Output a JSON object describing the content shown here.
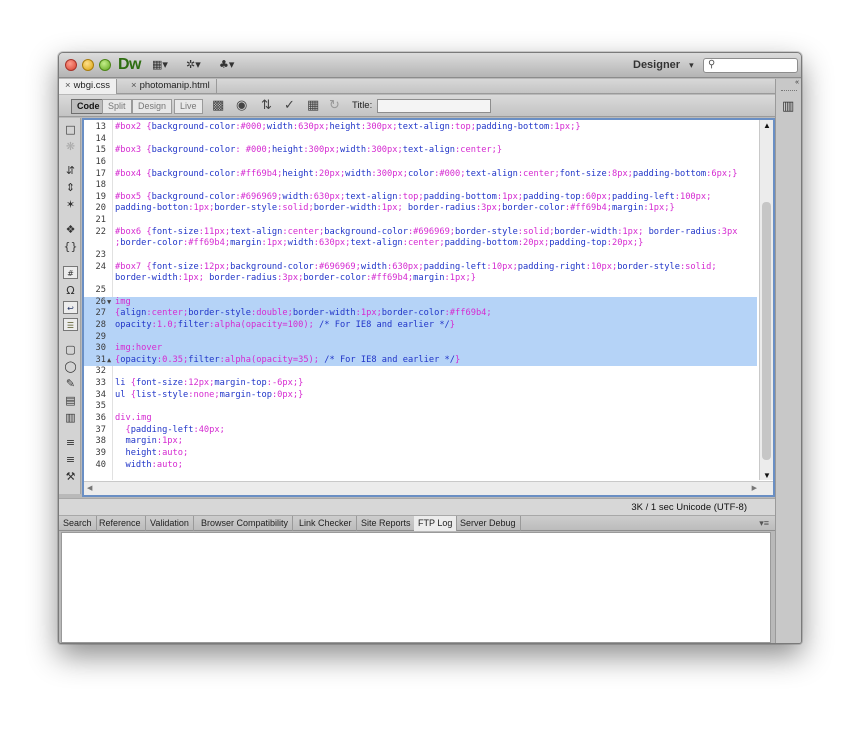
{
  "app": {
    "logo": "Dw",
    "workspace": "Designer",
    "workspace_caret": "▾",
    "search_placeholder": ""
  },
  "titlebar_icons": [
    "▦▾",
    "✲▾",
    "♣▾"
  ],
  "doc_tabs": [
    {
      "label": "wbgi.css",
      "close": "×"
    },
    {
      "label": "photomanip.html",
      "close": "×"
    }
  ],
  "toolbar": {
    "views": [
      "Code",
      "Split",
      "Design",
      "Live"
    ],
    "title_label": "Title:",
    "title_value": ""
  },
  "editor": {
    "lines": [
      {
        "n": "13",
        "t": "#box2 {background-color:#000;width:630px;height:300px;text-align:top;padding-bottom:1px;}"
      },
      {
        "n": "14",
        "t": ""
      },
      {
        "n": "15",
        "t": "#box3 {background-color: #000;height:300px;width:300px;text-align:center;}"
      },
      {
        "n": "16",
        "t": ""
      },
      {
        "n": "17",
        "t": "#box4 {background-color:#ff69b4;height:20px;width:300px;color:#000;text-align:center;font-size:8px;padding-bottom:6px;}"
      },
      {
        "n": "18",
        "t": ""
      },
      {
        "n": "19",
        "t": "#box5 {background-color:#696969;width:630px;text-align:top;padding-bottom:1px;padding-top:60px;padding-left:100px;"
      },
      {
        "n": "20",
        "t": "padding-botton:1px;border-style:solid;border-width:1px; border-radius:3px;border-color:#ff69b4;margin:1px;}"
      },
      {
        "n": "21",
        "t": ""
      },
      {
        "n": "22",
        "t": "#box6 {font-size:11px;text-align:center;background-color:#696969;border-style:solid;border-width:1px; border-radius:3px"
      },
      {
        "n": "",
        "t": ";border-color:#ff69b4;margin:1px;width:630px;text-align:center;padding-bottom:20px;padding-top:20px;}"
      },
      {
        "n": "23",
        "t": ""
      },
      {
        "n": "24",
        "t": "#box7 {font-size:12px;background-color:#696969;width:630px;padding-left:10px;padding-right:10px;border-style:solid;"
      },
      {
        "n": "",
        "t": "border-width:1px; border-radius:3px;border-color:#ff69b4;margin:1px;}"
      },
      {
        "n": "25",
        "t": ""
      },
      {
        "n": "26",
        "t": "img",
        "sel": true,
        "fold": "▼"
      },
      {
        "n": "27",
        "t": "{align:center;border-style:double;border-width:1px;border-color:#ff69b4;",
        "sel": true
      },
      {
        "n": "28",
        "t": "opacity:1.0;filter:alpha(opacity=100); /* For IE8 and earlier */}",
        "sel": true
      },
      {
        "n": "29",
        "t": "",
        "sel": true
      },
      {
        "n": "30",
        "t": "img:hover",
        "sel": true
      },
      {
        "n": "31",
        "t": "{opacity:0.35;filter:alpha(opacity=35); /* For IE8 and earlier */}",
        "sel": true,
        "fold": "▲"
      },
      {
        "n": "32",
        "t": ""
      },
      {
        "n": "33",
        "t": "li {font-size:12px;margin-top:-6px;}"
      },
      {
        "n": "34",
        "t": "ul {list-style:none;margin-top:0px;}"
      },
      {
        "n": "35",
        "t": ""
      },
      {
        "n": "36",
        "t": "div.img"
      },
      {
        "n": "37",
        "t": "  {padding-left:40px;"
      },
      {
        "n": "38",
        "t": "  margin:1px;"
      },
      {
        "n": "39",
        "t": "  height:auto;"
      },
      {
        "n": "40",
        "t": "  width:auto;"
      }
    ]
  },
  "status": {
    "text": "3K / 1 sec  Unicode (UTF-8)"
  },
  "panel_tabs": [
    "Search",
    "Reference",
    "Validation",
    "Browser Compatibility",
    "Link Checker",
    "Site Reports",
    "FTP Log",
    "Server Debug"
  ],
  "panel_active": "FTP Log"
}
